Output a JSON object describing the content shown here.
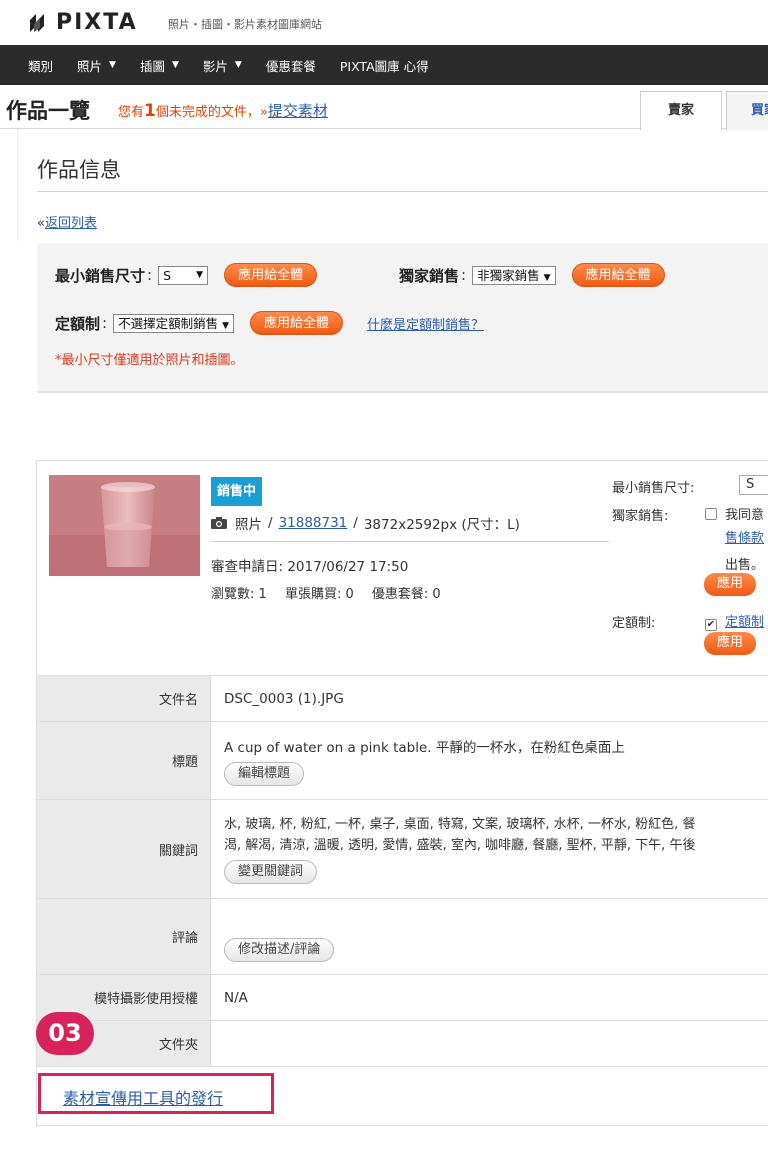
{
  "brand": {
    "name": "PIXTA",
    "tagline": "照片・插圖・影片素材圖庫網站"
  },
  "nav": [
    {
      "label": "類別",
      "dropdown": false
    },
    {
      "label": "照片",
      "dropdown": true
    },
    {
      "label": "插圖",
      "dropdown": true
    },
    {
      "label": "影片",
      "dropdown": true
    },
    {
      "label": "優惠套餐",
      "dropdown": false
    },
    {
      "label": "PIXTA圖庫 心得",
      "dropdown": false
    }
  ],
  "page": {
    "title": "作品一覽",
    "notice_pre": "您有",
    "notice_num": "1",
    "notice_post": "個未完成的文件，»",
    "notice_link": "提交素材",
    "tabs": [
      "賣家",
      "買家"
    ]
  },
  "section": {
    "title": "作品信息",
    "back_prefix": "«",
    "back_link": "返回列表"
  },
  "settings": {
    "min_size_label": "最小銷售尺寸",
    "min_size_value": "S",
    "apply_label": "應用給全體",
    "exclusive_label": "獨家銷售",
    "exclusive_value": "非獨家銷售",
    "fixed_label": "定額制",
    "fixed_value": "不選擇定額制銷售",
    "help_link": "什麼是定額制銷售？",
    "note": "*最小尺寸僅適用於照片和插圖。"
  },
  "item": {
    "status": "銷售中",
    "type": "照片",
    "id": "31888731",
    "dims": "3872x2592px (尺寸：L)",
    "review_date": "審查申請日: 2017/06/27 17:50",
    "views": "瀏覽數: 1",
    "single": "單張購買: 0",
    "package": "優惠套餐: 0",
    "min_size_label": "最小銷售尺寸:",
    "min_size_value": "S",
    "exclusive_label": "獨家銷售:",
    "exclusive_text": "我同意",
    "exclusive_link": "售條款",
    "exclusive_tail": "出售。",
    "apply_small": "應用",
    "fixed_label": "定額制:",
    "fixed_link": "定額制",
    "fixed_checked": true
  },
  "details": {
    "filename_label": "文件名",
    "filename": "DSC_0003 (1).JPG",
    "title_label": "標題",
    "title": "A cup of water on a pink table. 平靜的一杯水，在粉紅色桌面上",
    "edit_title": "編輯標題",
    "keywords_label": "關鍵詞",
    "keywords_line1": "水, 玻璃, 杯, 粉紅, 一杯, 桌子, 桌面, 特寫, 文案, 玻璃杯, 水杯, 一杯水, 粉紅色, 餐",
    "keywords_line2": "渴, 解渴, 清涼, 溫暖, 透明, 愛情, 盛裝, 室內, 咖啡廳, 餐廳, 聖杯, 平靜, 下午, 午後",
    "edit_keywords": "變更關鍵詞",
    "comment_label": "評論",
    "edit_comment": "修改描述/評論",
    "model_label": "模特攝影使用授權",
    "model_value": "N/A",
    "folder_label": "文件夾"
  },
  "callout": {
    "step": "03",
    "promo_link": "素材宣傳用工具的發行"
  },
  "colors": {
    "accent_orange": "#ef5a14",
    "badge_blue": "#1a9fd4",
    "callout_magenta": "#d6245b",
    "nav_bg": "#2b2b2b"
  }
}
